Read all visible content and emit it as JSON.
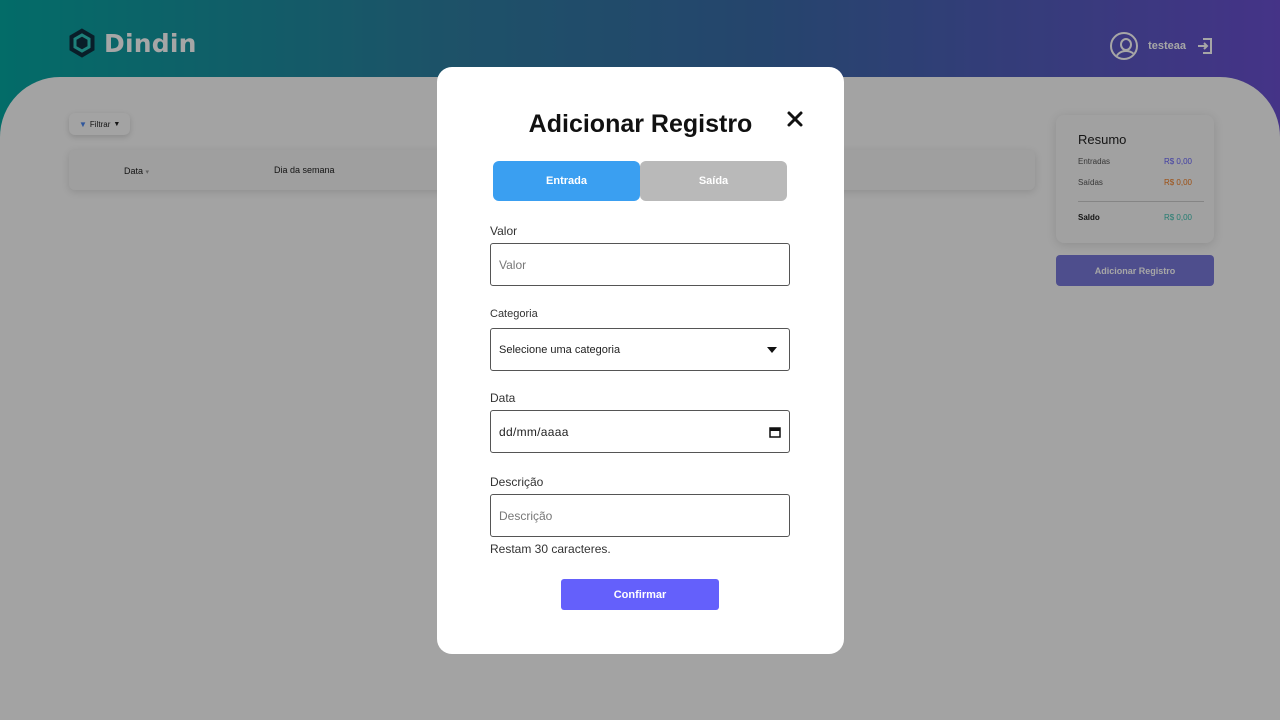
{
  "app": {
    "name": "Dindin",
    "username": "testeaa"
  },
  "toolbar": {
    "filter_label": "Filtrar"
  },
  "table": {
    "columns": [
      "Data",
      "Dia da semana"
    ]
  },
  "summary": {
    "title": "Resumo",
    "rows": [
      {
        "label": "Entradas",
        "value": "R$ 0,00"
      },
      {
        "label": "Saídas",
        "value": "R$ 0,00"
      }
    ],
    "balance_label": "Saldo",
    "balance_value": "R$ 0,00"
  },
  "add_button_label": "Adicionar Registro",
  "modal": {
    "title": "Adicionar Registro",
    "tabs": {
      "entrada": "Entrada",
      "saida": "Saída"
    },
    "valor": {
      "label": "Valor",
      "placeholder": "Valor"
    },
    "categoria": {
      "label": "Categoria",
      "selected": "Selecione uma categoria"
    },
    "data": {
      "label": "Data",
      "value": "dd/mm/aaaa"
    },
    "descricao": {
      "label": "Descrição",
      "placeholder": "Descrição",
      "helper": "Restam 30 caracteres."
    },
    "confirm_label": "Confirmar"
  },
  "colors": {
    "accent": "#6460fb",
    "entrada_tab": "#3a9ff1",
    "saida_tab": "#b9b9b9",
    "income": "#6460fb",
    "expense": "#f27b1d",
    "balance": "#3bc1b0"
  },
  "icons": [
    "hexagon-logo-icon",
    "user-avatar-icon",
    "logout-icon",
    "filter-icon",
    "sort-caret-icon",
    "close-icon",
    "dropdown-caret-icon",
    "calendar-icon"
  ]
}
